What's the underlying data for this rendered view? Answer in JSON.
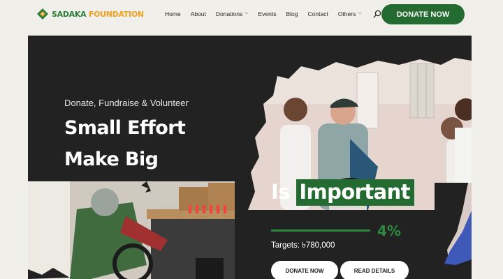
{
  "header": {
    "logo": {
      "name_part1": "SADAKA",
      "name_part2": " FOUNDATION"
    },
    "nav": [
      {
        "label": "Home",
        "has_dropdown": false
      },
      {
        "label": "About",
        "has_dropdown": false
      },
      {
        "label": "Donations",
        "has_dropdown": true
      },
      {
        "label": "Events",
        "has_dropdown": false
      },
      {
        "label": "Blog",
        "has_dropdown": false
      },
      {
        "label": "Contact",
        "has_dropdown": false
      },
      {
        "label": "Others",
        "has_dropdown": true
      }
    ],
    "donate_button": "DONATE NOW"
  },
  "hero": {
    "subtitle": "Donate, Fundraise & Volunteer",
    "title_line1": "Small Effort",
    "title_line2": "Make Big",
    "title_line3_prefix": "Is ",
    "title_line3_highlight": "Important",
    "progress": {
      "percent": 4,
      "label": "4%"
    },
    "targets": "Targets: ৳780,000",
    "buttons": {
      "donate": "DONATE NOW",
      "read": "READ DETAILS"
    }
  },
  "colors": {
    "brand_green": "#236b30",
    "accent_orange": "#f0a020",
    "hero_bg": "#222222",
    "page_bg": "#f1efea"
  }
}
